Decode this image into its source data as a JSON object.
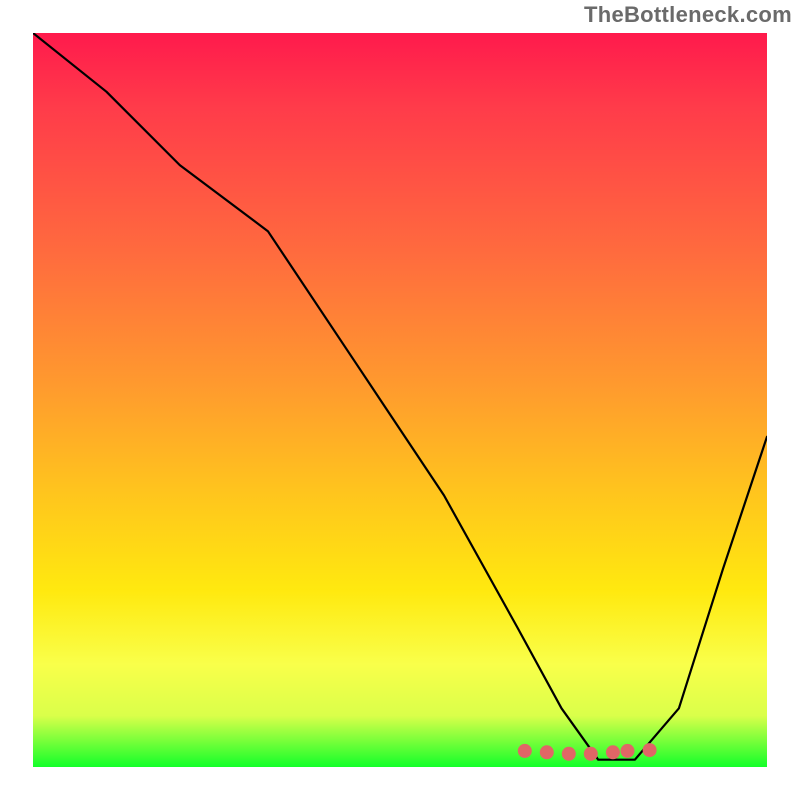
{
  "watermark": "TheBottleneck.com",
  "chart_data": {
    "type": "line",
    "title": "",
    "xlabel": "",
    "ylabel": "",
    "xlim": [
      0,
      100
    ],
    "ylim": [
      0,
      100
    ],
    "series": [
      {
        "name": "bottleneck-curve",
        "x": [
          0,
          10,
          20,
          32,
          44,
          56,
          66,
          72,
          77,
          82,
          88,
          94,
          100
        ],
        "values": [
          100,
          92,
          82,
          73,
          55,
          37,
          19,
          8,
          1,
          1,
          8,
          27,
          45
        ]
      }
    ],
    "highlight": {
      "name": "optimal-region",
      "x": [
        67,
        70,
        73,
        76,
        79,
        81,
        84
      ],
      "values": [
        2.2,
        2.0,
        1.8,
        1.8,
        2.0,
        2.2,
        2.3
      ],
      "color": "#e06666"
    },
    "colors": {
      "curve": "#000000",
      "gradient_top": "#ff1a4c",
      "gradient_mid": "#ffe90f",
      "gradient_bottom": "#13ff2a",
      "highlight": "#e06666"
    }
  }
}
